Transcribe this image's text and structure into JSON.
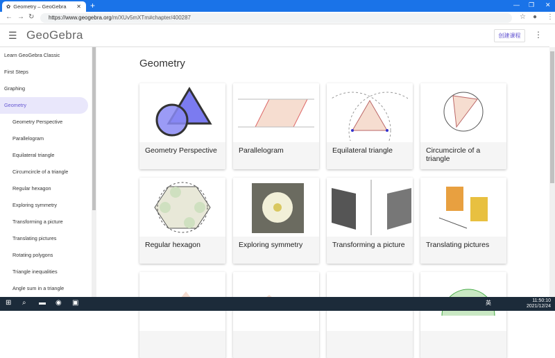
{
  "browser": {
    "tab_title": "Geometry – GeoGebra",
    "url_host": "https://www.geogebra.org",
    "url_path": "/m/XUv5mXTm#chapter/400287"
  },
  "app": {
    "logo": "GeoGebra",
    "create_button": "创建课程"
  },
  "sidebar": {
    "items": [
      {
        "label": "Learn GeoGebra Classic",
        "sub": false
      },
      {
        "label": "First Steps",
        "sub": false
      },
      {
        "label": "Graphing",
        "sub": false
      },
      {
        "label": "Geometry",
        "sub": false,
        "active": true
      },
      {
        "label": "Geometry Perspective",
        "sub": true
      },
      {
        "label": "Parallelogram",
        "sub": true
      },
      {
        "label": "Equilateral triangle",
        "sub": true
      },
      {
        "label": "Circumcircle of a triangle",
        "sub": true
      },
      {
        "label": "Regular hexagon",
        "sub": true
      },
      {
        "label": "Exploring symmetry",
        "sub": true
      },
      {
        "label": "Transforming a picture",
        "sub": true
      },
      {
        "label": "Translating pictures",
        "sub": true
      },
      {
        "label": "Rotating polygons",
        "sub": true
      },
      {
        "label": "Triangle inequalities",
        "sub": true
      },
      {
        "label": "Angle sum in a triangle",
        "sub": true
      }
    ]
  },
  "main": {
    "title": "Geometry",
    "cards": [
      {
        "title": "Geometry Perspective"
      },
      {
        "title": "Parallelogram"
      },
      {
        "title": "Equilateral triangle"
      },
      {
        "title": "Circumcircle of a triangle"
      },
      {
        "title": "Regular hexagon"
      },
      {
        "title": "Exploring symmetry"
      },
      {
        "title": "Transforming a picture"
      },
      {
        "title": "Translating pictures"
      },
      {
        "title": ""
      },
      {
        "title": ""
      },
      {
        "title": ""
      },
      {
        "title": ""
      }
    ]
  },
  "taskbar": {
    "time": "11:50:10",
    "date": "2021/12/24",
    "ime": "英"
  }
}
